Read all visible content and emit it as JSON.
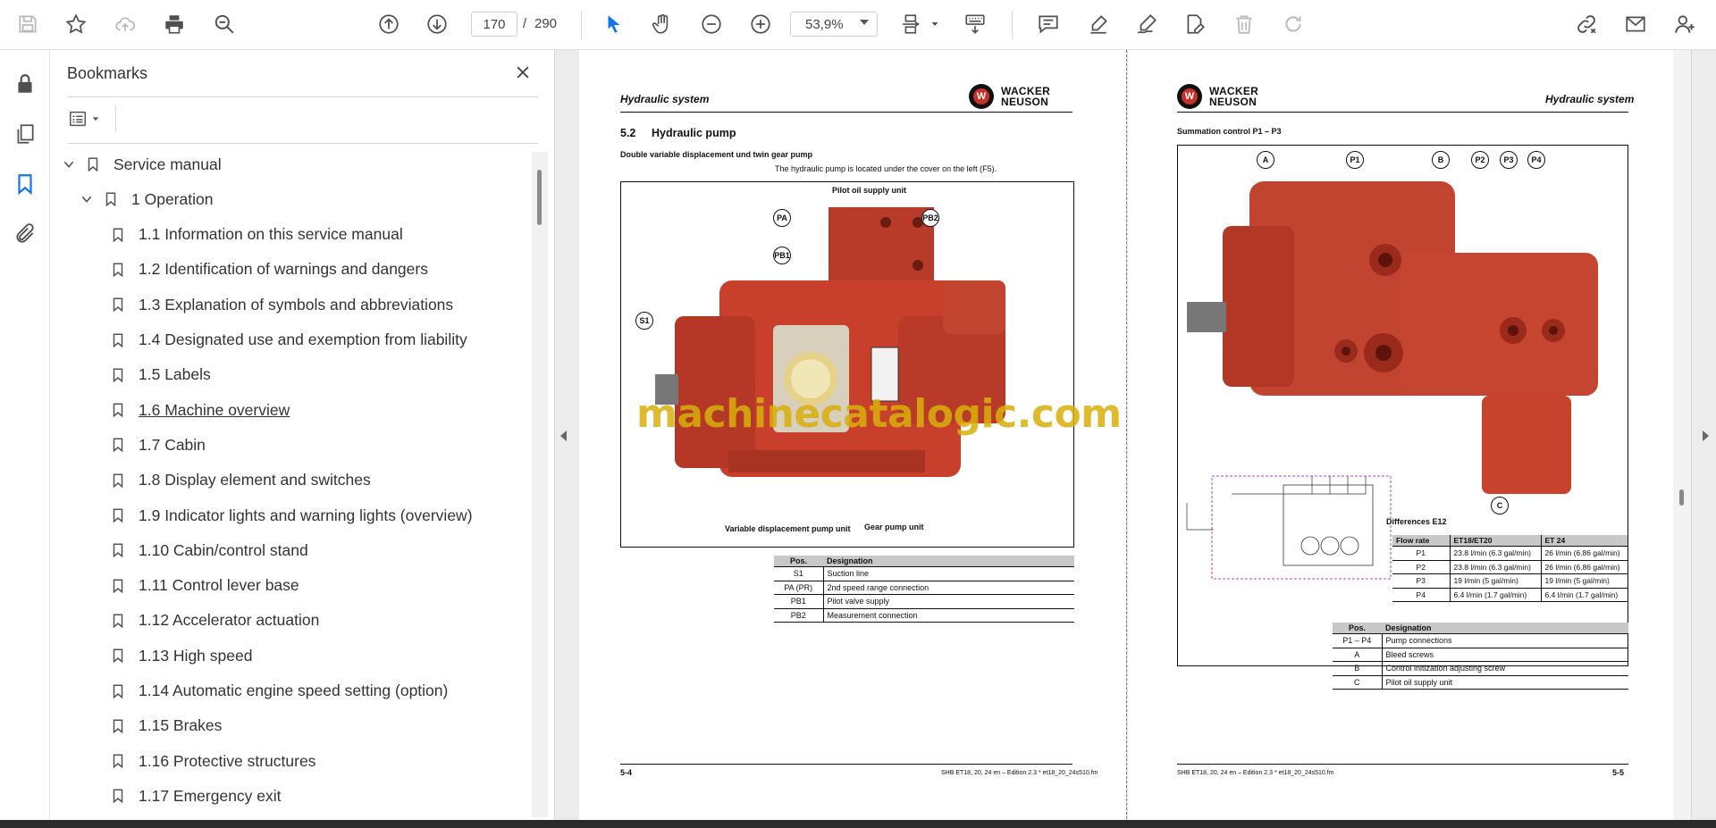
{
  "toolbar": {
    "current_page": "170",
    "page_separator": "/",
    "total_pages": "290",
    "zoom": "53,9%",
    "icons": [
      "save-icon",
      "star-icon",
      "cloud-upload-icon",
      "print-icon",
      "zoom-search-icon",
      "page-up-icon",
      "page-down-icon",
      "select-cursor-icon",
      "hand-icon",
      "zoom-out-icon",
      "zoom-in-icon",
      "page-fit-icon",
      "scroll-mode-icon",
      "comment-icon",
      "highlight-icon",
      "sign-icon",
      "edit-pdf-icon",
      "delete-icon",
      "redo-icon",
      "share-link-icon",
      "email-icon",
      "account-icon"
    ]
  },
  "left_rail": {
    "icons": [
      "lock-icon",
      "pages-icon",
      "bookmark-icon",
      "attachment-icon"
    ]
  },
  "bookmarks": {
    "title": "Bookmarks",
    "items": [
      {
        "label": "Service manual",
        "level": 0,
        "expanded": true
      },
      {
        "label": "1 Operation",
        "level": 1,
        "expanded": true
      },
      {
        "label": "1.1 Information on this service manual",
        "level": 2
      },
      {
        "label": "1.2 Identification of warnings and dangers",
        "level": 2
      },
      {
        "label": "1.3 Explanation of symbols and abbreviations",
        "level": 2
      },
      {
        "label": "1.4 Designated use and exemption from liability",
        "level": 2
      },
      {
        "label": "1.5 Labels",
        "level": 2
      },
      {
        "label": "1.6 Machine overview",
        "level": 2,
        "active": true
      },
      {
        "label": "1.7 Cabin",
        "level": 2
      },
      {
        "label": "1.8 Display element and switches",
        "level": 2
      },
      {
        "label": "1.9 Indicator lights and warning lights (overview)",
        "level": 2
      },
      {
        "label": "1.10 Cabin/control stand",
        "level": 2
      },
      {
        "label": "1.11 Control lever base",
        "level": 2
      },
      {
        "label": "1.12 Accelerator actuation",
        "level": 2
      },
      {
        "label": "1.13 High speed",
        "level": 2
      },
      {
        "label": "1.14 Automatic engine speed setting (option)",
        "level": 2
      },
      {
        "label": "1.15 Brakes",
        "level": 2
      },
      {
        "label": "1.16 Protective structures",
        "level": 2
      },
      {
        "label": "1.17 Emergency exit",
        "level": 2
      }
    ]
  },
  "page_left": {
    "header": "Hydraulic system",
    "logo_line1": "WACKER",
    "logo_line2": "NEUSON",
    "section_number": "5.2",
    "section_title": "Hydraulic pump",
    "subtitle": "Double variable displacement und twin gear pump",
    "note": "The hydraulic pump is located under the cover on the left (F5).",
    "figure_labels": {
      "pilot": "Pilot oil supply unit",
      "variable": "Variable displacement pump unit",
      "gear": "Gear pump unit"
    },
    "callouts": [
      "PA",
      "PB2",
      "PB1",
      "S1"
    ],
    "table_headers": [
      "Pos.",
      "Designation"
    ],
    "table_rows": [
      {
        "pos": "S1",
        "designation": "Suction line"
      },
      {
        "pos": "PA (PR)",
        "designation": "2nd speed range connection"
      },
      {
        "pos": "PB1",
        "designation": "Pilot valve supply"
      },
      {
        "pos": "PB2",
        "designation": "Measurement connection"
      }
    ],
    "footer_page": "5-4",
    "footer_text": "SHB ET18, 20, 24 en – Edition 2.3 * et18_20_24s510.fm"
  },
  "page_right": {
    "header": "Hydraulic system",
    "logo_line1": "WACKER",
    "logo_line2": "NEUSON",
    "subtitle": "Summation control P1 – P3",
    "callouts": [
      "A",
      "P1",
      "B",
      "P2",
      "P3",
      "P4",
      "C"
    ],
    "differences_title": "Differences E12",
    "flow_headers": [
      "Flow rate",
      "ET18/ET20",
      "ET 24"
    ],
    "flow_rows": [
      {
        "p": "P1",
        "a": "23.8 l/min (6.3 gal/min)",
        "b": "26 l/min (6.86 gal/min)"
      },
      {
        "p": "P2",
        "a": "23.8 l/min (6.3 gal/min)",
        "b": "26 l/min (6.86 gal/min)"
      },
      {
        "p": "P3",
        "a": "19 l/min (5 gal/min)",
        "b": "19 l/min (5 gal/min)"
      },
      {
        "p": "P4",
        "a": "6.4 l/min (1.7 gal/min)",
        "b": "6.4 l/min (1.7 gal/min)"
      }
    ],
    "table_headers": [
      "Pos.",
      "Designation"
    ],
    "table_rows": [
      {
        "pos": "P1 – P4",
        "designation": "Pump connections"
      },
      {
        "pos": "A",
        "designation": "Bleed screws"
      },
      {
        "pos": "B",
        "designation": "Control initization adjusting screw"
      },
      {
        "pos": "C",
        "designation": "Pilot oil supply unit"
      }
    ],
    "footer_page": "5-5",
    "footer_text": "SHB ET18, 20, 24 en – Edition 2.3 * et18_20_24s510.fm"
  },
  "watermark": "machinecatalogic.com",
  "colors": {
    "accent": "#1473e6",
    "pump_red": "#c8402c",
    "watermark": "#d9b00a"
  }
}
